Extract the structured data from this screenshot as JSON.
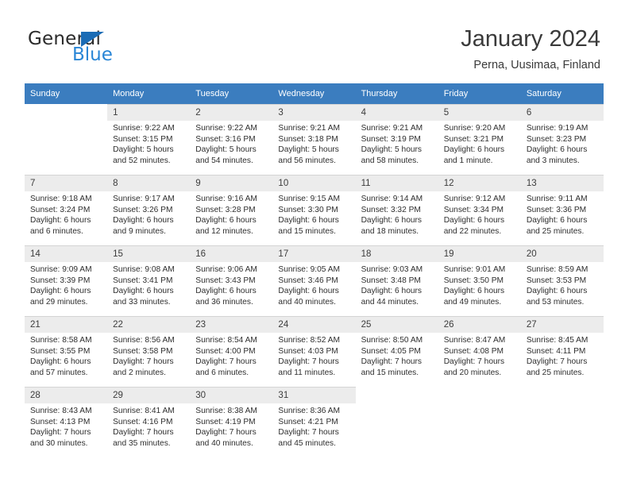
{
  "brand": {
    "word_one": "General",
    "word_two": "Blue",
    "accent_dark": "#1b6cb5",
    "accent_light": "#2a86d6"
  },
  "header": {
    "title": "January 2024",
    "subtitle": "Perna, Uusimaa, Finland"
  },
  "theme": {
    "header_row_bg": "#3b7dbf",
    "day_number_bg": "#ececec",
    "text": "#2e2e2e"
  },
  "weekdays": [
    "Sunday",
    "Monday",
    "Tuesday",
    "Wednesday",
    "Thursday",
    "Friday",
    "Saturday"
  ],
  "labels": {
    "sunrise_prefix": "Sunrise:",
    "sunset_prefix": "Sunset:",
    "daylight_prefix": "Daylight:"
  },
  "weeks": [
    [
      {
        "day": "",
        "sunrise": "",
        "sunset": "",
        "daylight_a": "",
        "daylight_b": ""
      },
      {
        "day": "1",
        "sunrise": "Sunrise: 9:22 AM",
        "sunset": "Sunset: 3:15 PM",
        "daylight_a": "Daylight: 5 hours",
        "daylight_b": "and 52 minutes."
      },
      {
        "day": "2",
        "sunrise": "Sunrise: 9:22 AM",
        "sunset": "Sunset: 3:16 PM",
        "daylight_a": "Daylight: 5 hours",
        "daylight_b": "and 54 minutes."
      },
      {
        "day": "3",
        "sunrise": "Sunrise: 9:21 AM",
        "sunset": "Sunset: 3:18 PM",
        "daylight_a": "Daylight: 5 hours",
        "daylight_b": "and 56 minutes."
      },
      {
        "day": "4",
        "sunrise": "Sunrise: 9:21 AM",
        "sunset": "Sunset: 3:19 PM",
        "daylight_a": "Daylight: 5 hours",
        "daylight_b": "and 58 minutes."
      },
      {
        "day": "5",
        "sunrise": "Sunrise: 9:20 AM",
        "sunset": "Sunset: 3:21 PM",
        "daylight_a": "Daylight: 6 hours",
        "daylight_b": "and 1 minute."
      },
      {
        "day": "6",
        "sunrise": "Sunrise: 9:19 AM",
        "sunset": "Sunset: 3:23 PM",
        "daylight_a": "Daylight: 6 hours",
        "daylight_b": "and 3 minutes."
      }
    ],
    [
      {
        "day": "7",
        "sunrise": "Sunrise: 9:18 AM",
        "sunset": "Sunset: 3:24 PM",
        "daylight_a": "Daylight: 6 hours",
        "daylight_b": "and 6 minutes."
      },
      {
        "day": "8",
        "sunrise": "Sunrise: 9:17 AM",
        "sunset": "Sunset: 3:26 PM",
        "daylight_a": "Daylight: 6 hours",
        "daylight_b": "and 9 minutes."
      },
      {
        "day": "9",
        "sunrise": "Sunrise: 9:16 AM",
        "sunset": "Sunset: 3:28 PM",
        "daylight_a": "Daylight: 6 hours",
        "daylight_b": "and 12 minutes."
      },
      {
        "day": "10",
        "sunrise": "Sunrise: 9:15 AM",
        "sunset": "Sunset: 3:30 PM",
        "daylight_a": "Daylight: 6 hours",
        "daylight_b": "and 15 minutes."
      },
      {
        "day": "11",
        "sunrise": "Sunrise: 9:14 AM",
        "sunset": "Sunset: 3:32 PM",
        "daylight_a": "Daylight: 6 hours",
        "daylight_b": "and 18 minutes."
      },
      {
        "day": "12",
        "sunrise": "Sunrise: 9:12 AM",
        "sunset": "Sunset: 3:34 PM",
        "daylight_a": "Daylight: 6 hours",
        "daylight_b": "and 22 minutes."
      },
      {
        "day": "13",
        "sunrise": "Sunrise: 9:11 AM",
        "sunset": "Sunset: 3:36 PM",
        "daylight_a": "Daylight: 6 hours",
        "daylight_b": "and 25 minutes."
      }
    ],
    [
      {
        "day": "14",
        "sunrise": "Sunrise: 9:09 AM",
        "sunset": "Sunset: 3:39 PM",
        "daylight_a": "Daylight: 6 hours",
        "daylight_b": "and 29 minutes."
      },
      {
        "day": "15",
        "sunrise": "Sunrise: 9:08 AM",
        "sunset": "Sunset: 3:41 PM",
        "daylight_a": "Daylight: 6 hours",
        "daylight_b": "and 33 minutes."
      },
      {
        "day": "16",
        "sunrise": "Sunrise: 9:06 AM",
        "sunset": "Sunset: 3:43 PM",
        "daylight_a": "Daylight: 6 hours",
        "daylight_b": "and 36 minutes."
      },
      {
        "day": "17",
        "sunrise": "Sunrise: 9:05 AM",
        "sunset": "Sunset: 3:46 PM",
        "daylight_a": "Daylight: 6 hours",
        "daylight_b": "and 40 minutes."
      },
      {
        "day": "18",
        "sunrise": "Sunrise: 9:03 AM",
        "sunset": "Sunset: 3:48 PM",
        "daylight_a": "Daylight: 6 hours",
        "daylight_b": "and 44 minutes."
      },
      {
        "day": "19",
        "sunrise": "Sunrise: 9:01 AM",
        "sunset": "Sunset: 3:50 PM",
        "daylight_a": "Daylight: 6 hours",
        "daylight_b": "and 49 minutes."
      },
      {
        "day": "20",
        "sunrise": "Sunrise: 8:59 AM",
        "sunset": "Sunset: 3:53 PM",
        "daylight_a": "Daylight: 6 hours",
        "daylight_b": "and 53 minutes."
      }
    ],
    [
      {
        "day": "21",
        "sunrise": "Sunrise: 8:58 AM",
        "sunset": "Sunset: 3:55 PM",
        "daylight_a": "Daylight: 6 hours",
        "daylight_b": "and 57 minutes."
      },
      {
        "day": "22",
        "sunrise": "Sunrise: 8:56 AM",
        "sunset": "Sunset: 3:58 PM",
        "daylight_a": "Daylight: 7 hours",
        "daylight_b": "and 2 minutes."
      },
      {
        "day": "23",
        "sunrise": "Sunrise: 8:54 AM",
        "sunset": "Sunset: 4:00 PM",
        "daylight_a": "Daylight: 7 hours",
        "daylight_b": "and 6 minutes."
      },
      {
        "day": "24",
        "sunrise": "Sunrise: 8:52 AM",
        "sunset": "Sunset: 4:03 PM",
        "daylight_a": "Daylight: 7 hours",
        "daylight_b": "and 11 minutes."
      },
      {
        "day": "25",
        "sunrise": "Sunrise: 8:50 AM",
        "sunset": "Sunset: 4:05 PM",
        "daylight_a": "Daylight: 7 hours",
        "daylight_b": "and 15 minutes."
      },
      {
        "day": "26",
        "sunrise": "Sunrise: 8:47 AM",
        "sunset": "Sunset: 4:08 PM",
        "daylight_a": "Daylight: 7 hours",
        "daylight_b": "and 20 minutes."
      },
      {
        "day": "27",
        "sunrise": "Sunrise: 8:45 AM",
        "sunset": "Sunset: 4:11 PM",
        "daylight_a": "Daylight: 7 hours",
        "daylight_b": "and 25 minutes."
      }
    ],
    [
      {
        "day": "28",
        "sunrise": "Sunrise: 8:43 AM",
        "sunset": "Sunset: 4:13 PM",
        "daylight_a": "Daylight: 7 hours",
        "daylight_b": "and 30 minutes."
      },
      {
        "day": "29",
        "sunrise": "Sunrise: 8:41 AM",
        "sunset": "Sunset: 4:16 PM",
        "daylight_a": "Daylight: 7 hours",
        "daylight_b": "and 35 minutes."
      },
      {
        "day": "30",
        "sunrise": "Sunrise: 8:38 AM",
        "sunset": "Sunset: 4:19 PM",
        "daylight_a": "Daylight: 7 hours",
        "daylight_b": "and 40 minutes."
      },
      {
        "day": "31",
        "sunrise": "Sunrise: 8:36 AM",
        "sunset": "Sunset: 4:21 PM",
        "daylight_a": "Daylight: 7 hours",
        "daylight_b": "and 45 minutes."
      },
      {
        "day": "",
        "sunrise": "",
        "sunset": "",
        "daylight_a": "",
        "daylight_b": ""
      },
      {
        "day": "",
        "sunrise": "",
        "sunset": "",
        "daylight_a": "",
        "daylight_b": ""
      },
      {
        "day": "",
        "sunrise": "",
        "sunset": "",
        "daylight_a": "",
        "daylight_b": ""
      }
    ]
  ]
}
